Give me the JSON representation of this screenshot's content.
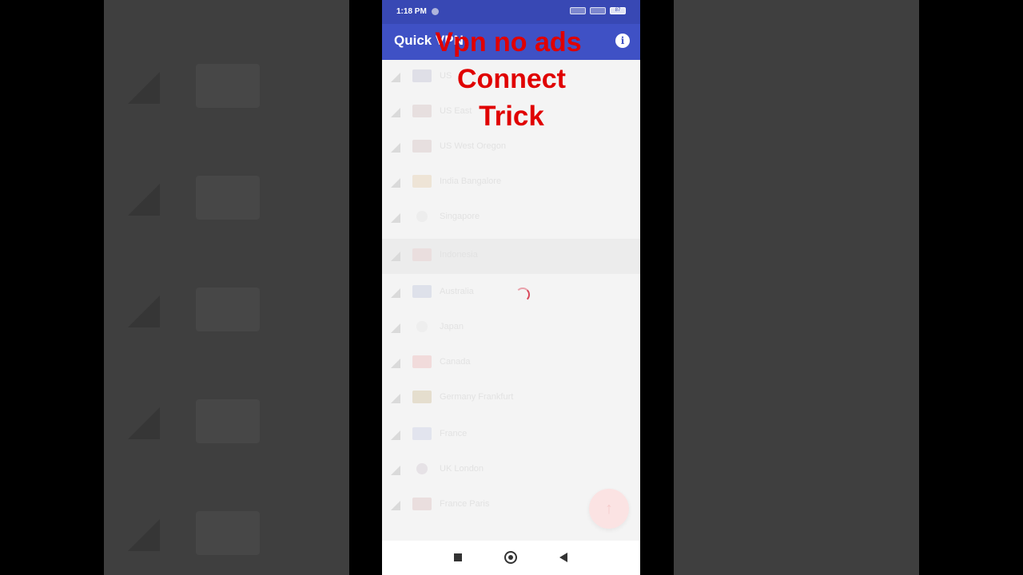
{
  "status_bar": {
    "time": "1:18 PM",
    "battery": "87"
  },
  "app_bar": {
    "title": "Quick VPN"
  },
  "overlay": {
    "line1": "Vpn no ads",
    "line2": "Connect",
    "line3": "Trick"
  },
  "servers": [
    {
      "label": "US",
      "flag_color": "#c9c9d9"
    },
    {
      "label": "US East",
      "flag_color": "#d9c9c9"
    },
    {
      "label": "US West Oregon",
      "flag_color": "#d9c9c9"
    },
    {
      "label": "India Bangalore",
      "flag_color": "#e8d4b8"
    },
    {
      "label": "Singapore",
      "flag_color": "#e6e6e6"
    },
    {
      "label": "Indonesia",
      "flag_color": "#e8cfcf"
    },
    {
      "label": "Australia",
      "flag_color": "#c8cde0"
    },
    {
      "label": "Japan",
      "flag_color": "#e8e8e8"
    },
    {
      "label": "Canada",
      "flag_color": "#eec1c1"
    },
    {
      "label": "Germany Frankfurt",
      "flag_color": "#d6c7a8"
    },
    {
      "label": "France",
      "flag_color": "#d0d4e8"
    },
    {
      "label": "UK London",
      "flag_color": "#d8d0d8"
    },
    {
      "label": "France Paris",
      "flag_color": "#e0c8c8"
    }
  ],
  "colors": {
    "primary": "#3f51c5",
    "status": "#3848b4",
    "overlay_text": "#e00000"
  },
  "icons": {
    "info": "info-icon",
    "fab": "arrow-up-icon"
  }
}
